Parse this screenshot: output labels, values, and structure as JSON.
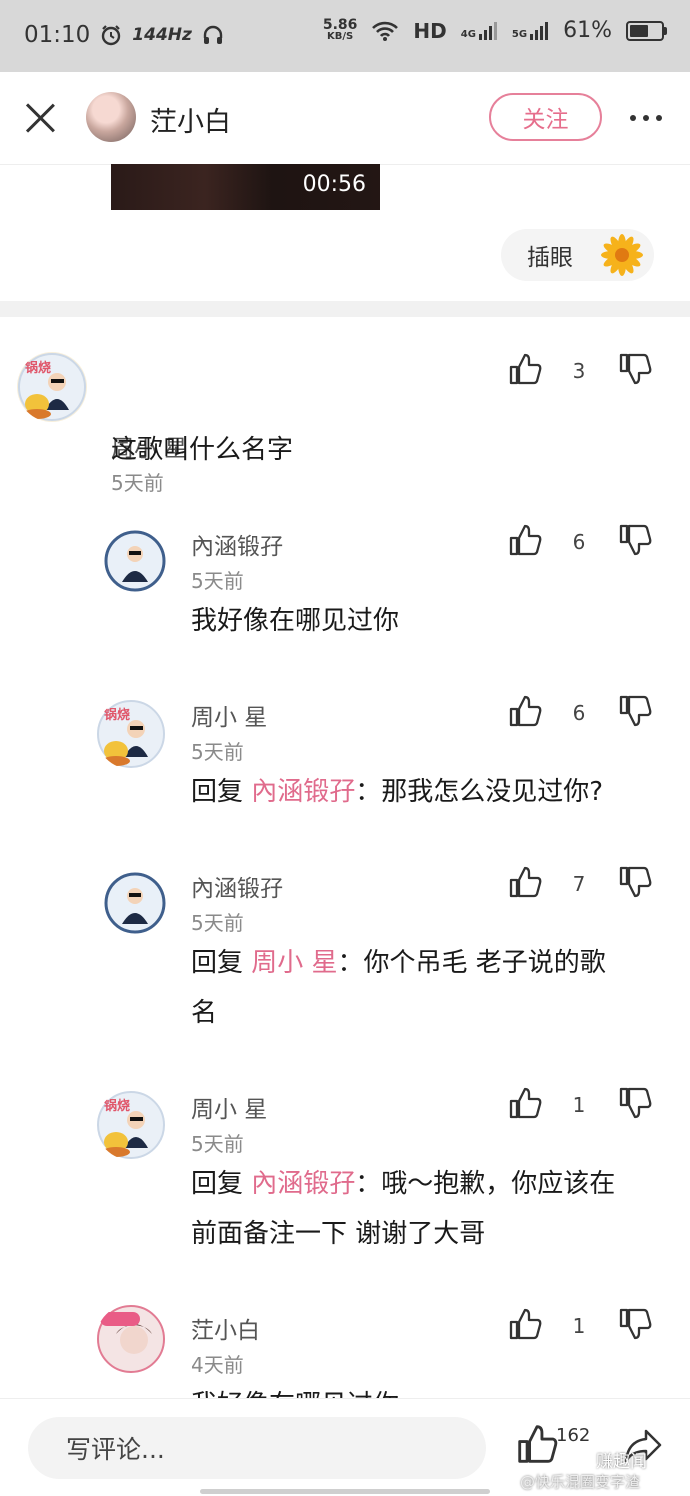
{
  "status_bar": {
    "time": "01:10",
    "refresh_rate": "144Hz",
    "net_speed_value": "5.86",
    "net_speed_unit": "KB/S",
    "hd": "HD",
    "net_4g": "4G",
    "net_5g": "5G",
    "battery_percent": "61%",
    "battery_level": 0.61
  },
  "header": {
    "username": "茳小白",
    "follow_label": "关注"
  },
  "video": {
    "duration": "00:56"
  },
  "chip": {
    "label": "插眼"
  },
  "comments": [
    {
      "name": "周小 星",
      "time": "5天前",
      "text": "这歌叫什么名字",
      "likes": "3"
    },
    {
      "name": "內涵锻孖",
      "time": "5天前",
      "text": "我好像在哪见过你",
      "likes": "6"
    },
    {
      "name": "周小 星",
      "time": "5天前",
      "reply_prefix": "回复 ",
      "mention": "內涵锻孖",
      "text": "：那我怎么没见过你?",
      "likes": "6"
    },
    {
      "name": "內涵锻孖",
      "time": "5天前",
      "reply_prefix": "回复 ",
      "mention": "周小 星",
      "text": "：你个吊毛 老子说的歌",
      "text2": "名",
      "likes": "7"
    },
    {
      "name": "周小 星",
      "time": "5天前",
      "reply_prefix": "回复 ",
      "mention": "內涵锻孖",
      "text": "：哦～抱歉，你应该在",
      "text2": "前面备注一下 谢谢了大哥",
      "likes": "1"
    },
    {
      "name": "茳小白",
      "time": "4天前",
      "text": "我好像在哪见过你",
      "likes": "1"
    }
  ],
  "bottom": {
    "input_placeholder": "写评论...",
    "like_count": "162",
    "watermark_top": "赚趣闻",
    "watermark_bottom": "@快乐混圈变字渣"
  },
  "colors": {
    "accent_pink": "#e06b8c",
    "status_bar_bg": "#d8d8d8"
  }
}
